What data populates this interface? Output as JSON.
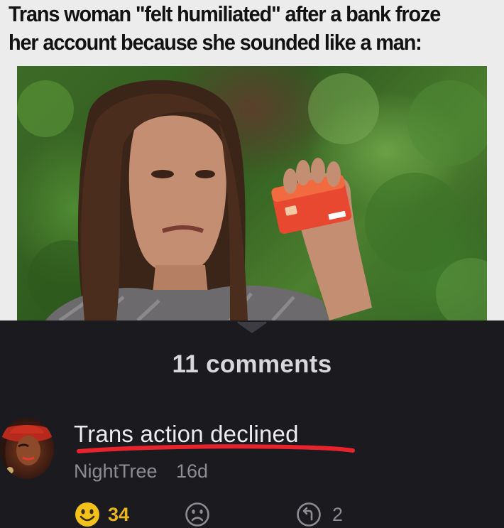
{
  "meme": {
    "headline": "Trans woman \"felt humiliated\" after a bank froze her account because she sounded like a man:"
  },
  "comments_section": {
    "count_label": "11 comments"
  },
  "comment": {
    "text": "Trans action declined",
    "author": "NightTree",
    "age": "16d",
    "likes": "34",
    "replies": "2",
    "underline_color": "#e8232e",
    "like_color": "#e8b51a"
  },
  "icons": {
    "collapse": "chevron-down-icon",
    "like": "smile-icon",
    "dislike": "frown-icon",
    "reply": "reply-icon"
  }
}
